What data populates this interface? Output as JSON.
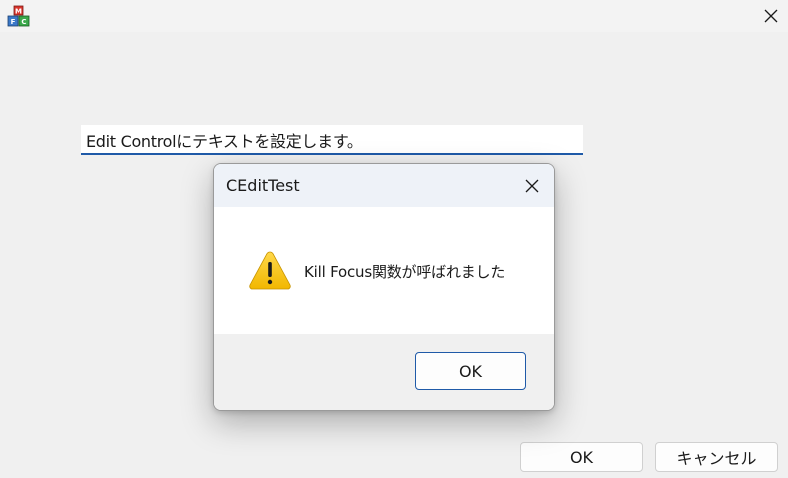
{
  "window": {
    "app_icon": "mfc-app-icon",
    "close_icon": "close-icon"
  },
  "edit_control": {
    "value": "Edit Controlにテキストを設定します。"
  },
  "buttons": {
    "ok_label": "OK",
    "cancel_label": "キャンセル"
  },
  "message_box": {
    "title": "CEditTest",
    "close_icon": "close-icon",
    "icon": "warning-icon",
    "message": "Kill Focus関数が呼ばれました",
    "ok_label": "OK"
  },
  "colors": {
    "accent": "#1f5aa8",
    "warning": "#f7c300",
    "background": "#f0f0f0"
  }
}
